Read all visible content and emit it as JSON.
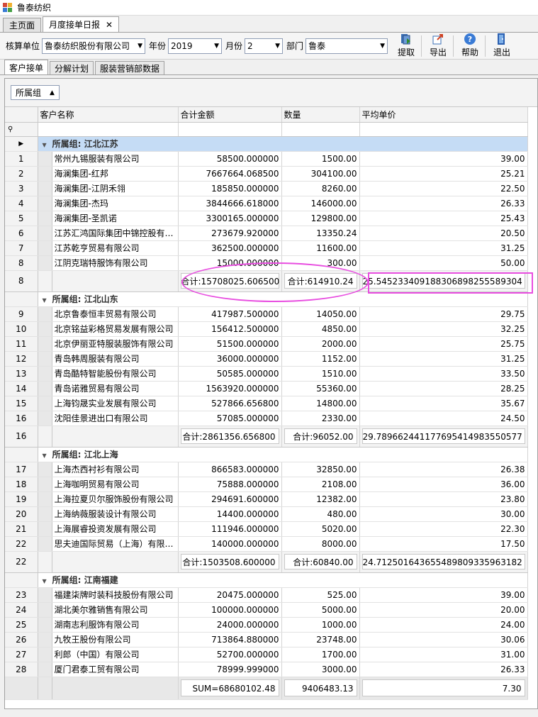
{
  "window": {
    "title": "鲁泰纺织"
  },
  "doc_tabs": [
    {
      "label": "主页面"
    },
    {
      "label": "月度接单日报",
      "close": "✕"
    }
  ],
  "toolbar": {
    "unit_label": "核算单位",
    "unit_value": "鲁泰纺织股份有限公司",
    "year_label": "年份",
    "year_value": "2019",
    "month_label": "月份",
    "month_value": "2",
    "dept_label": "部门",
    "dept_value": "鲁泰",
    "extract_label": "提取",
    "export_label": "导出",
    "help_label": "帮助",
    "exit_label": "退出"
  },
  "sub_tabs": [
    {
      "label": "客户接单"
    },
    {
      "label": "分解计划"
    },
    {
      "label": "服装营销部数据"
    }
  ],
  "group_by": {
    "label": "所属组"
  },
  "columns": {
    "customer": "客户名称",
    "amount": "合计金额",
    "qty": "数量",
    "price": "平均单价"
  },
  "groups": [
    {
      "label": "所属组: 江北江苏",
      "rows": [
        {
          "idx": "1",
          "name": "常州九锡服装有限公司",
          "amount": "58500.000000",
          "qty": "1500.00",
          "price": "39.00"
        },
        {
          "idx": "2",
          "name": "海澜集团-红邦",
          "amount": "7667664.068500",
          "qty": "304100.00",
          "price": "25.21"
        },
        {
          "idx": "3",
          "name": "海澜集团-江阴禾翎",
          "amount": "185850.000000",
          "qty": "8260.00",
          "price": "22.50"
        },
        {
          "idx": "4",
          "name": "海澜集团-杰玛",
          "amount": "3844666.618000",
          "qty": "146000.00",
          "price": "26.33"
        },
        {
          "idx": "5",
          "name": "海澜集团-圣凯诺",
          "amount": "3300165.000000",
          "qty": "129800.00",
          "price": "25.43"
        },
        {
          "idx": "6",
          "name": "江苏汇鸿国际集团中锦控股有…",
          "amount": "273679.920000",
          "qty": "13350.24",
          "price": "20.50"
        },
        {
          "idx": "7",
          "name": "江苏乾亨贸易有限公司",
          "amount": "362500.000000",
          "qty": "11600.00",
          "price": "31.25"
        },
        {
          "idx": "8",
          "name": "江阴克瑞特服饰有限公司",
          "amount": "15000.000000",
          "qty": "300.00",
          "price": "50.00"
        }
      ],
      "summary": {
        "idx": "8",
        "amount": "合计:15708025.606500",
        "qty": "合计:614910.24",
        "price": "25.54523340918830689825558930­4"
      }
    },
    {
      "label": "所属组: 江北山东",
      "rows": [
        {
          "idx": "9",
          "name": "北京鲁泰恒丰贸易有限公司",
          "amount": "417987.500000",
          "qty": "14050.00",
          "price": "29.75"
        },
        {
          "idx": "10",
          "name": "北京铭益彩格贸易发展有限公司",
          "amount": "156412.500000",
          "qty": "4850.00",
          "price": "32.25"
        },
        {
          "idx": "11",
          "name": "北京伊丽亚特服装服饰有限公司",
          "amount": "51500.000000",
          "qty": "2000.00",
          "price": "25.75"
        },
        {
          "idx": "12",
          "name": "青岛韩周服装有限公司",
          "amount": "36000.000000",
          "qty": "1152.00",
          "price": "31.25"
        },
        {
          "idx": "13",
          "name": "青岛酷特智能股份有限公司",
          "amount": "50585.000000",
          "qty": "1510.00",
          "price": "33.50"
        },
        {
          "idx": "14",
          "name": "青岛诺雅贸易有限公司",
          "amount": "1563920.000000",
          "qty": "55360.00",
          "price": "28.25"
        },
        {
          "idx": "15",
          "name": "上海钧晟实业发展有限公司",
          "amount": "527866.656800",
          "qty": "14800.00",
          "price": "35.67"
        },
        {
          "idx": "16",
          "name": "沈阳佳景进出口有限公司",
          "amount": "57085.000000",
          "qty": "2330.00",
          "price": "24.50"
        }
      ],
      "summary": {
        "idx": "16",
        "amount": "合计:2861356.656800",
        "qty": "合计:96052.00",
        "price": "29.7896624411776954149835505­77"
      }
    },
    {
      "label": "所属组: 江北上海",
      "rows": [
        {
          "idx": "17",
          "name": "上海杰西衬衫有限公司",
          "amount": "866583.000000",
          "qty": "32850.00",
          "price": "26.38"
        },
        {
          "idx": "18",
          "name": "上海咖明贸易有限公司",
          "amount": "75888.000000",
          "qty": "2108.00",
          "price": "36.00"
        },
        {
          "idx": "19",
          "name": "上海拉夏贝尔服饰股份有限公司",
          "amount": "294691.600000",
          "qty": "12382.00",
          "price": "23.80"
        },
        {
          "idx": "20",
          "name": "上海纳薇服装设计有限公司",
          "amount": "14400.000000",
          "qty": "480.00",
          "price": "30.00"
        },
        {
          "idx": "21",
          "name": "上海展睿投资发展有限公司",
          "amount": "111946.000000",
          "qty": "5020.00",
          "price": "22.30"
        },
        {
          "idx": "22",
          "name": "思夫迪国际贸易（上海）有限…",
          "amount": "140000.000000",
          "qty": "8000.00",
          "price": "17.50"
        }
      ],
      "summary": {
        "idx": "22",
        "amount": "合计:1503508.600000",
        "qty": "合计:60840.00",
        "price": "24.7125016436554898093359631­82"
      }
    },
    {
      "label": "所属组: 江南福建",
      "rows": [
        {
          "idx": "23",
          "name": "福建柒牌时装科技股份有限公司",
          "amount": "20475.000000",
          "qty": "525.00",
          "price": "39.00"
        },
        {
          "idx": "24",
          "name": "湖北美尔雅销售有限公司",
          "amount": "100000.000000",
          "qty": "5000.00",
          "price": "20.00"
        },
        {
          "idx": "25",
          "name": "湖南志利服饰有限公司",
          "amount": "24000.000000",
          "qty": "1000.00",
          "price": "24.00"
        },
        {
          "idx": "26",
          "name": "九牧王股份有限公司",
          "amount": "713864.880000",
          "qty": "23748.00",
          "price": "30.06"
        },
        {
          "idx": "27",
          "name": "利郎（中国）有限公司",
          "amount": "52700.000000",
          "qty": "1700.00",
          "price": "31.00"
        },
        {
          "idx": "28",
          "name": "厦门君泰工贸有限公司",
          "amount": "78999.999000",
          "qty": "3000.00",
          "price": "26.33"
        }
      ]
    }
  ],
  "footer": {
    "amount": "SUM=68680102.48",
    "qty": "9406483.13",
    "price": "7.30"
  },
  "annotation_color": "#e84de0",
  "focus_row_color": "#c5dcf5"
}
